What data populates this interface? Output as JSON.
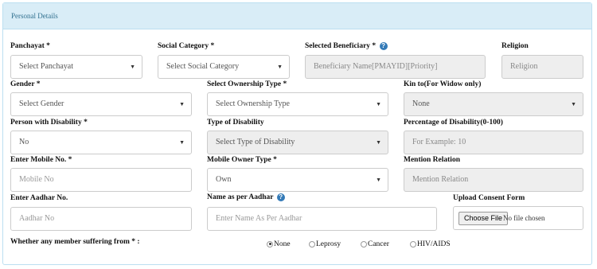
{
  "panel": {
    "title": "Personal Details"
  },
  "fields": {
    "panchayat": {
      "label": "Panchayat *",
      "value": "Select Panchayat"
    },
    "social_category": {
      "label": "Social Category *",
      "value": "Select Social Category"
    },
    "selected_beneficiary": {
      "label": "Selected Beneficiary *",
      "placeholder": "Beneficiary Name[PMAYID][Priority]"
    },
    "religion": {
      "label": "Religion",
      "placeholder": "Religion"
    },
    "gender": {
      "label": "Gender *",
      "value": "Select Gender"
    },
    "ownership_type": {
      "label": "Select Ownership Type *",
      "value": "Select Ownership Type"
    },
    "kin_to": {
      "label": "Kin to(For Widow only)",
      "value": "None"
    },
    "disability": {
      "label": "Person with Disability *",
      "value": "No"
    },
    "type_of_disability": {
      "label": "Type of Disability",
      "value": "Select Type of Disability"
    },
    "percentage_disability": {
      "label": "Percentage of Disability(0-100)",
      "placeholder": "For Example: 10"
    },
    "mobile": {
      "label": "Enter Mobile No. *",
      "placeholder": "Mobile No"
    },
    "mobile_owner_type": {
      "label": "Mobile Owner Type *",
      "value": "Own"
    },
    "mention_relation": {
      "label": "Mention Relation",
      "placeholder": "Mention Relation"
    },
    "aadhar": {
      "label": "Enter Aadhar No.",
      "placeholder": "Aadhar No"
    },
    "name_as_aadhar": {
      "label": "Name as per Aadhar",
      "placeholder": "Enter Name As Per Aadhar"
    },
    "consent_form": {
      "label": "Upload Consent Form",
      "button": "Choose File",
      "status": "No file chosen"
    }
  },
  "suffering": {
    "label": "Whether any member suffering from * :",
    "options": [
      "None",
      "Leprosy",
      "Cancer",
      "HIV/AIDS"
    ],
    "selected": "None"
  },
  "icons": {
    "help": "?",
    "caret": "▼"
  }
}
